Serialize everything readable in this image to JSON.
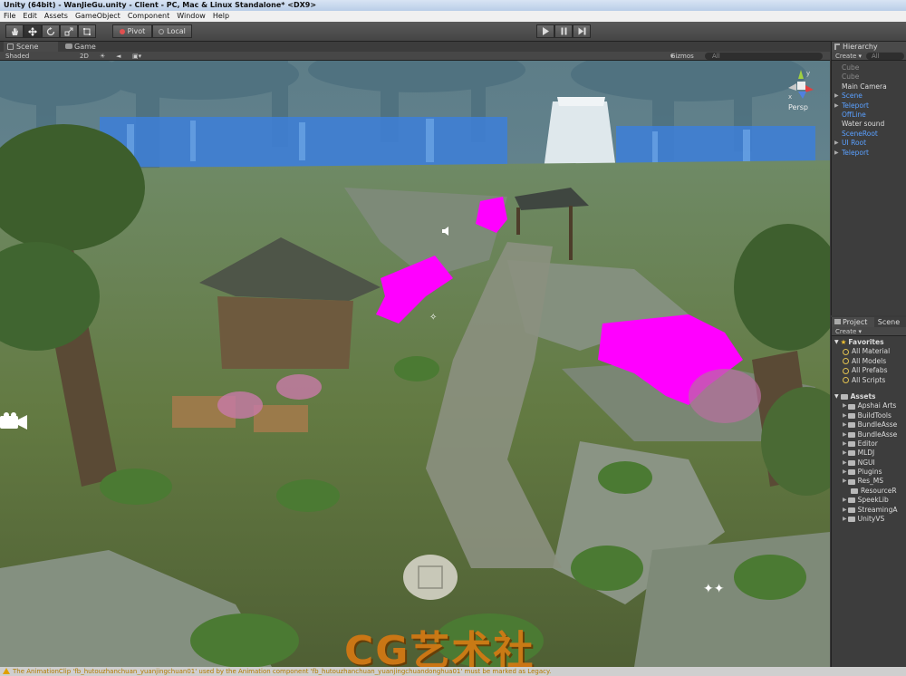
{
  "window": {
    "title": "Unity (64bit) - WanJieGu.unity - Client - PC, Mac & Linux Standalone* <DX9>"
  },
  "menu": [
    "File",
    "Edit",
    "Assets",
    "GameObject",
    "Component",
    "Window",
    "Help"
  ],
  "toolbar": {
    "pivot_label": "Pivot",
    "local_label": "Local"
  },
  "scene": {
    "tabs": [
      {
        "label": "Scene",
        "active": true
      },
      {
        "label": "Game",
        "active": false
      }
    ],
    "shading": "Shaded",
    "mode_2d": "2D",
    "gizmos_label": "Gizmos",
    "search_placeholder": "All",
    "persp_label": "Persp"
  },
  "hierarchy": {
    "tab_label": "Hierarchy",
    "create_label": "Create",
    "search_placeholder": "All",
    "items": [
      {
        "label": "Cube",
        "color": "#8a8a8a",
        "arrow": false
      },
      {
        "label": "Cube",
        "color": "#8a8a8a",
        "arrow": false
      },
      {
        "label": "Main Camera",
        "color": "#dddddd",
        "arrow": false
      },
      {
        "label": "Scene",
        "color": "#5aa0ff",
        "arrow": true
      },
      {
        "label": "Teleport",
        "color": "#5aa0ff",
        "arrow": true
      },
      {
        "label": "OffLine",
        "color": "#5aa0ff",
        "arrow": false
      },
      {
        "label": "Water sound",
        "color": "#dddddd",
        "arrow": false
      },
      {
        "label": "SceneRoot",
        "color": "#5aa0ff",
        "arrow": false
      },
      {
        "label": "UI Root",
        "color": "#5aa0ff",
        "arrow": true
      },
      {
        "label": "Teleport",
        "color": "#5aa0ff",
        "arrow": true
      }
    ]
  },
  "project": {
    "tab_label": "Project",
    "tab2_label": "Scene",
    "create_label": "Create",
    "favorites_label": "Favorites",
    "favorites": [
      "All Material",
      "All Models",
      "All Prefabs",
      "All Scripts"
    ],
    "assets_label": "Assets",
    "folders": [
      "Apshai Arts",
      "BuildTools",
      "BundleAsse",
      "BundleAsse",
      "Editor",
      "MLDJ",
      "NGUI",
      "Plugins",
      "Res_MS",
      "ResourceR",
      "SpeekLib",
      "StreamingA",
      "UnityVS"
    ]
  },
  "status": {
    "message": "The AnimationClip 'fb_hutouzhanchuan_yuanjingchuan01' used by the Animation component 'fb_hutouzhanchuan_yuanjingchuandonghua01' must be marked as Legacy."
  },
  "watermark": "CG艺术社",
  "colors": {
    "missing_material": "#ff00ff",
    "selection_blue": "#5aa0ff",
    "watermark_orange": "#e07a10"
  }
}
